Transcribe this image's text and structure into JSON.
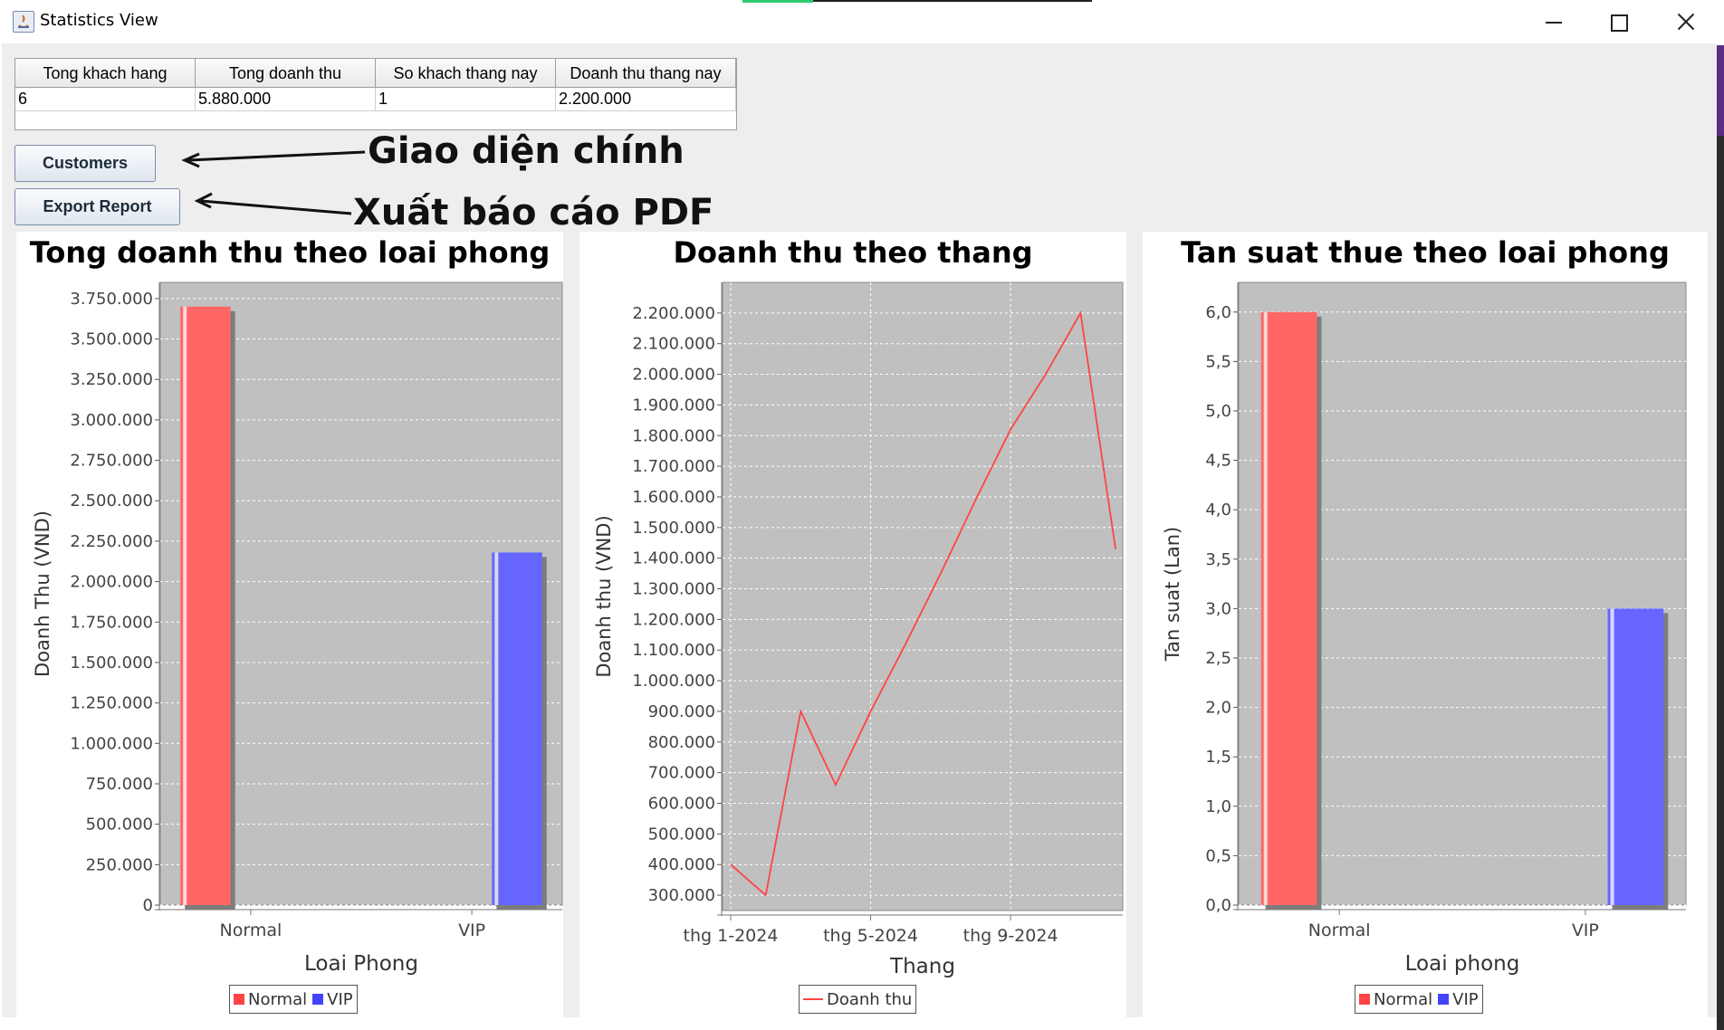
{
  "window": {
    "title": "Statistics View"
  },
  "stats": {
    "headers": [
      "Tong khach hang",
      "Tong doanh thu",
      "So khach thang nay",
      "Doanh thu thang nay"
    ],
    "values": [
      "6",
      "5.880.000",
      "1",
      "2.200.000"
    ]
  },
  "buttons": {
    "customers": "Customers",
    "export": "Export Report"
  },
  "annotations": {
    "main_ui": "Giao diện chính",
    "export_pdf": "Xuất báo cáo PDF"
  },
  "colors": {
    "normal": "#ff6666",
    "vip": "#6666ff",
    "line": "#ff4444",
    "plot_bg": "#c0c0c0"
  },
  "chart_data": [
    {
      "type": "bar",
      "title": "Tong doanh thu theo loai phong",
      "xlabel": "Loai Phong",
      "ylabel": "Doanh Thu (VND)",
      "categories": [
        "Normal",
        "VIP"
      ],
      "series": [
        {
          "name": "Normal",
          "values": [
            3700000,
            null
          ]
        },
        {
          "name": "VIP",
          "values": [
            null,
            2180000
          ]
        }
      ],
      "ylim": [
        0,
        3850000
      ],
      "yticks": [
        0,
        250000,
        500000,
        750000,
        1000000,
        1250000,
        1500000,
        1750000,
        2000000,
        2250000,
        2500000,
        2750000,
        3000000,
        3250000,
        3500000,
        3750000
      ],
      "ytick_labels": [
        "0",
        "250.000",
        "500.000",
        "750.000",
        "1.000.000",
        "1.250.000",
        "1.500.000",
        "1.750.000",
        "2.000.000",
        "2.250.000",
        "2.500.000",
        "2.750.000",
        "3.000.000",
        "3.250.000",
        "3.500.000",
        "3.750.000"
      ],
      "legend": "bottom",
      "grid": true
    },
    {
      "type": "line",
      "title": "Doanh thu theo thang",
      "xlabel": "Thang",
      "ylabel": "Doanh thu (VND)",
      "x": [
        "2024-01",
        "2024-02",
        "2024-03",
        "2024-04",
        "2024-05",
        "2024-06",
        "2024-07",
        "2024-08",
        "2024-09",
        "2024-10",
        "2024-11",
        "2024-12"
      ],
      "series": [
        {
          "name": "Doanh thu",
          "values": [
            400000,
            300000,
            900000,
            660000,
            900000,
            1120000,
            1350000,
            1590000,
            1820000,
            2000000,
            2200000,
            1430000
          ]
        }
      ],
      "xticks": [
        "2024-01",
        "2024-05",
        "2024-09"
      ],
      "xtick_labels": [
        "thg 1-2024",
        "thg 5-2024",
        "thg 9-2024"
      ],
      "ylim": [
        250000,
        2300000
      ],
      "yticks": [
        300000,
        400000,
        500000,
        600000,
        700000,
        800000,
        900000,
        1000000,
        1100000,
        1200000,
        1300000,
        1400000,
        1500000,
        1600000,
        1700000,
        1800000,
        1900000,
        2000000,
        2100000,
        2200000
      ],
      "ytick_labels": [
        "300.000",
        "400.000",
        "500.000",
        "600.000",
        "700.000",
        "800.000",
        "900.000",
        "1.000.000",
        "1.100.000",
        "1.200.000",
        "1.300.000",
        "1.400.000",
        "1.500.000",
        "1.600.000",
        "1.700.000",
        "1.800.000",
        "1.900.000",
        "2.000.000",
        "2.100.000",
        "2.200.000"
      ],
      "legend": "bottom",
      "grid": true
    },
    {
      "type": "bar",
      "title": "Tan suat thue theo loai phong",
      "xlabel": "Loai phong",
      "ylabel": "Tan suat (Lan)",
      "categories": [
        "Normal",
        "VIP"
      ],
      "series": [
        {
          "name": "Normal",
          "values": [
            6,
            null
          ]
        },
        {
          "name": "VIP",
          "values": [
            null,
            3
          ]
        }
      ],
      "ylim": [
        0,
        6.3
      ],
      "yticks": [
        0,
        0.5,
        1,
        1.5,
        2,
        2.5,
        3,
        3.5,
        4,
        4.5,
        5,
        5.5,
        6
      ],
      "ytick_labels": [
        "0,0",
        "0,5",
        "1,0",
        "1,5",
        "2,0",
        "2,5",
        "3,0",
        "3,5",
        "4,0",
        "4,5",
        "5,0",
        "5,5",
        "6,0"
      ],
      "legend": "bottom",
      "grid": true
    }
  ]
}
